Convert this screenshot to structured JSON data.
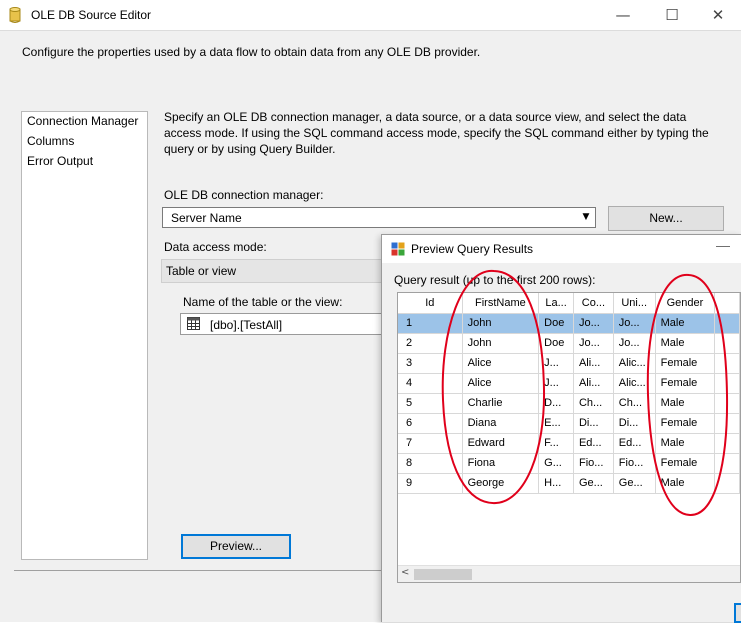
{
  "window": {
    "title": "OLE DB Source Editor",
    "minimize": "—",
    "maximize": "☐",
    "close": "✕"
  },
  "description": "Configure the properties used by a data flow to obtain data from any OLE DB provider.",
  "nav": {
    "items": [
      {
        "label": "Connection Manager"
      },
      {
        "label": "Columns"
      },
      {
        "label": "Error Output"
      }
    ]
  },
  "instructions": "Specify an OLE DB connection manager, a data source, or a data source view, and select the data access mode. If using the SQL command access mode, specify the SQL command either by typing the query or by using Query Builder.",
  "connection": {
    "label": "OLE DB connection manager:",
    "value": "Server Name",
    "new_button": "New..."
  },
  "access_mode": {
    "label": "Data access mode:",
    "value": "Table or view"
  },
  "table": {
    "label": "Name of the table or the view:",
    "value": "[dbo].[TestAll]"
  },
  "preview_button": "Preview...",
  "preview_window": {
    "title": "Preview Query Results",
    "minimize": "—",
    "caption": "Query result (up to the first 200 rows):",
    "columns": [
      "Id",
      "FirstName",
      "La...",
      "Co...",
      "Uni...",
      "Gender"
    ],
    "rows": [
      [
        "1",
        "John",
        "Doe",
        "Jo...",
        "Jo...",
        "Male"
      ],
      [
        "2",
        "John",
        "Doe",
        "Jo...",
        "Jo...",
        "Male"
      ],
      [
        "3",
        "Alice",
        "J...",
        "Ali...",
        "Alic...",
        "Female"
      ],
      [
        "4",
        "Alice",
        "J...",
        "Ali...",
        "Alic...",
        "Female"
      ],
      [
        "5",
        "Charlie",
        "D...",
        "Ch...",
        "Ch...",
        "Male"
      ],
      [
        "6",
        "Diana",
        "E...",
        "Di...",
        "Di...",
        "Female"
      ],
      [
        "7",
        "Edward",
        "F...",
        "Ed...",
        "Ed...",
        "Male"
      ],
      [
        "8",
        "Fiona",
        "G...",
        "Fio...",
        "Fio...",
        "Female"
      ],
      [
        "9",
        "George",
        "H...",
        "Ge...",
        "Ge...",
        "Male"
      ]
    ],
    "selected_row": 0,
    "scroll_left": "<"
  },
  "colors": {
    "selection": "#9cc3e8",
    "annotation": "#e0001b",
    "focus": "#0078d7"
  }
}
